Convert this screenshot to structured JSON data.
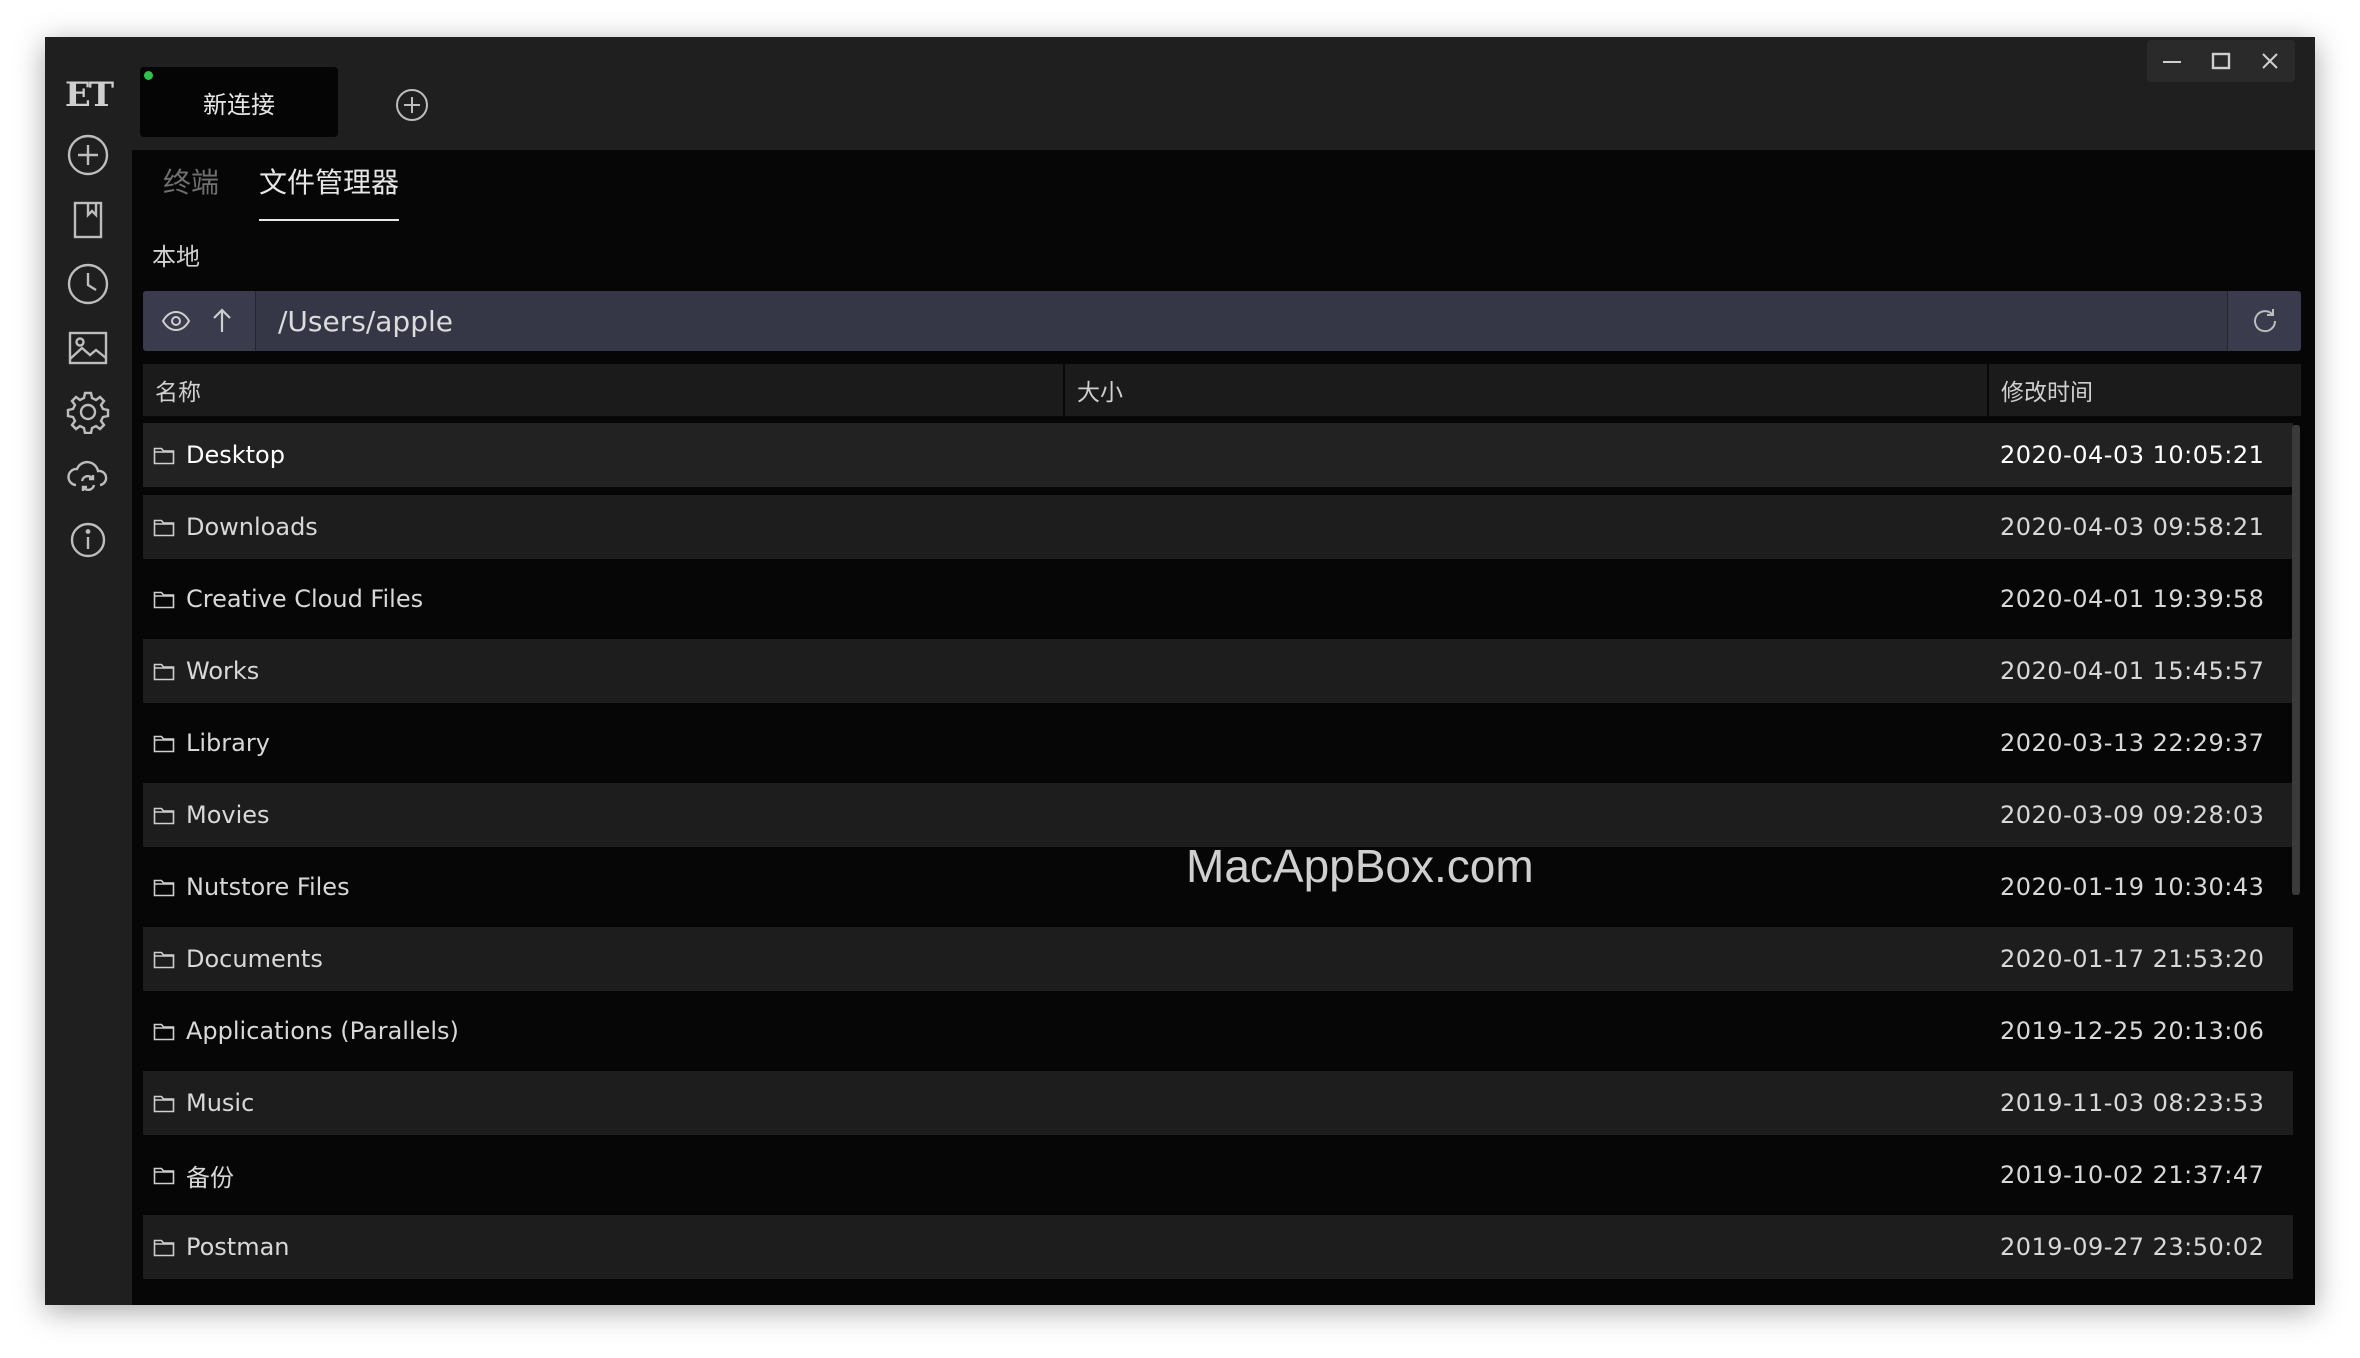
{
  "app": {
    "logo": "ET"
  },
  "sidebar": {
    "items": [
      {
        "name": "new-connection",
        "icon": "plus-circle-icon"
      },
      {
        "name": "bookmarks",
        "icon": "bookmark-icon"
      },
      {
        "name": "history",
        "icon": "clock-icon"
      },
      {
        "name": "themes",
        "icon": "image-icon"
      },
      {
        "name": "settings",
        "icon": "gear-icon"
      },
      {
        "name": "cloud-sync",
        "icon": "cloud-sync-icon"
      },
      {
        "name": "about",
        "icon": "info-icon"
      }
    ]
  },
  "tabs": {
    "connection_label": "新连接",
    "connected": true
  },
  "subtabs": {
    "terminal": "终端",
    "file_manager": "文件管理器",
    "active": "file_manager"
  },
  "panel": {
    "label": "本地",
    "path": "/Users/apple"
  },
  "table": {
    "headers": {
      "name": "名称",
      "size": "大小",
      "modified": "修改时间"
    },
    "rows": [
      {
        "name": "Desktop",
        "size": "",
        "modified": "2020-04-03 10:05:21"
      },
      {
        "name": "Downloads",
        "size": "",
        "modified": "2020-04-03 09:58:21"
      },
      {
        "name": "Creative Cloud Files",
        "size": "",
        "modified": "2020-04-01 19:39:58"
      },
      {
        "name": "Works",
        "size": "",
        "modified": "2020-04-01 15:45:57"
      },
      {
        "name": "Library",
        "size": "",
        "modified": "2020-03-13 22:29:37"
      },
      {
        "name": "Movies",
        "size": "",
        "modified": "2020-03-09 09:28:03"
      },
      {
        "name": "Nutstore Files",
        "size": "",
        "modified": "2020-01-19 10:30:43"
      },
      {
        "name": "Documents",
        "size": "",
        "modified": "2020-01-17 21:53:20"
      },
      {
        "name": "Applications (Parallels)",
        "size": "",
        "modified": "2019-12-25 20:13:06"
      },
      {
        "name": "Music",
        "size": "",
        "modified": "2019-11-03 08:23:53"
      },
      {
        "name": "备份",
        "size": "",
        "modified": "2019-10-02 21:37:47"
      },
      {
        "name": "Postman",
        "size": "",
        "modified": "2019-09-27 23:50:02"
      }
    ]
  },
  "watermark": "MacAppBox.com",
  "colors": {
    "background": "#060606",
    "sidebar": "#1f1f1f",
    "pathbar": "#3a3b4d",
    "status": "#2fc24a"
  }
}
